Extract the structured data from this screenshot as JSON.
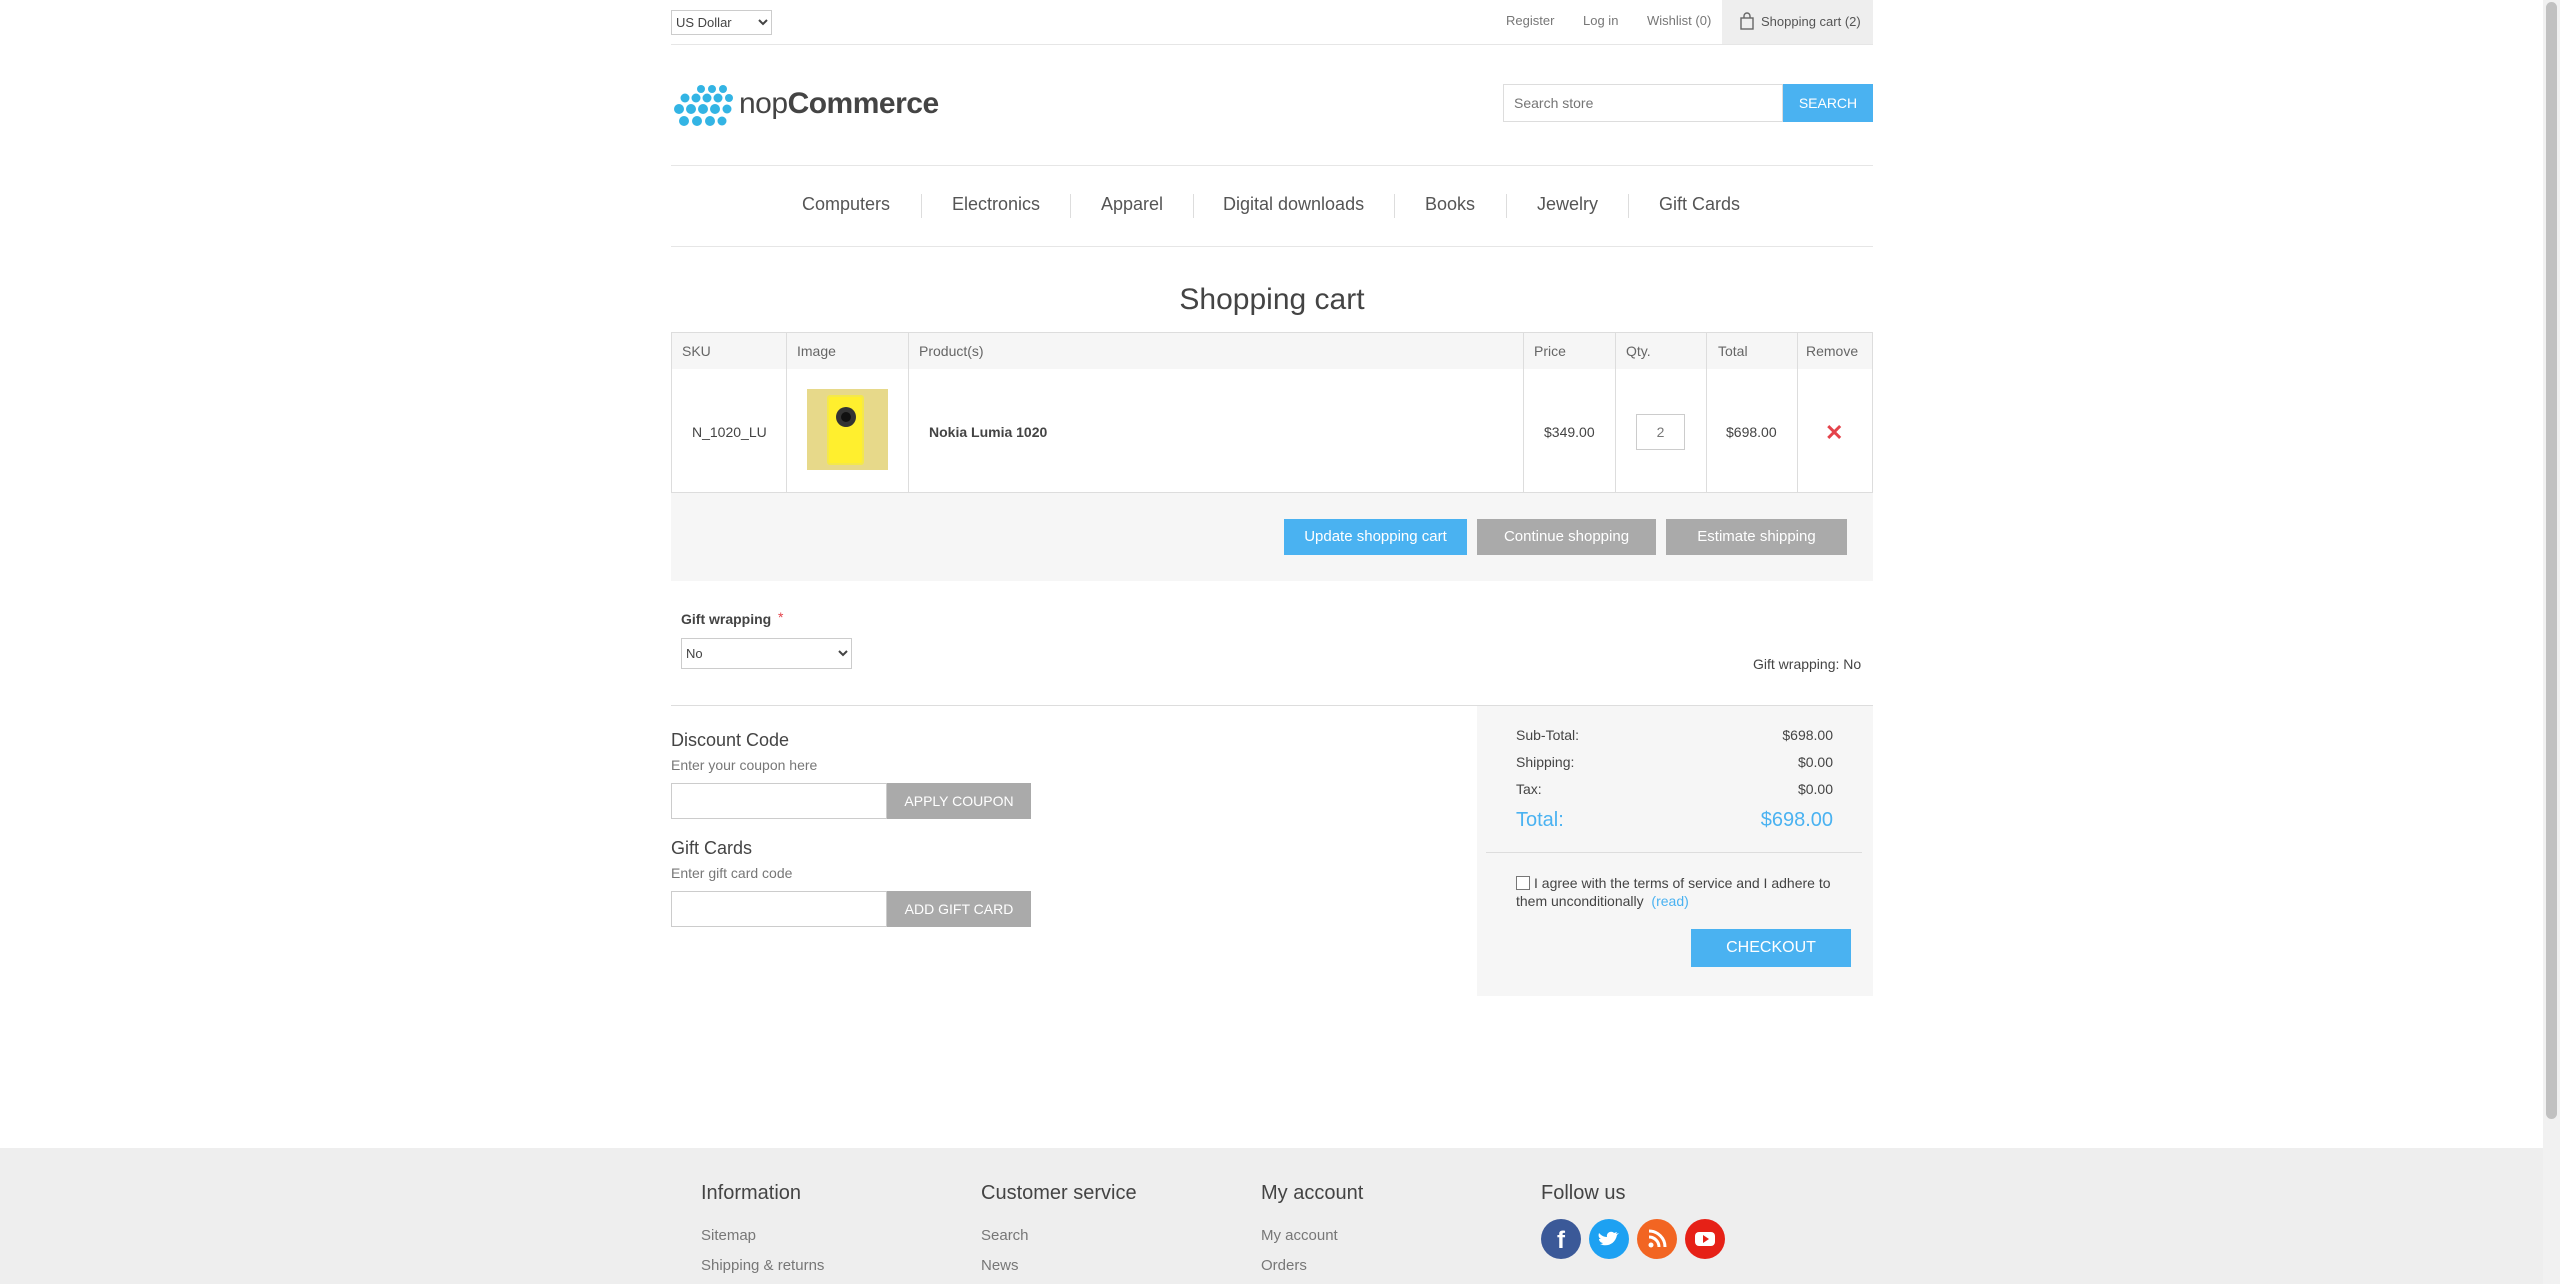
{
  "header": {
    "currency": "US Dollar",
    "links": {
      "register": "Register",
      "login": "Log in",
      "wishlist": "Wishlist (0)",
      "cart": "Shopping cart (2)"
    },
    "logo": {
      "light": "nop",
      "bold": "Commerce"
    },
    "search": {
      "placeholder": "Search store",
      "button": "SEARCH"
    }
  },
  "nav": [
    "Computers",
    "Electronics",
    "Apparel",
    "Digital downloads",
    "Books",
    "Jewelry",
    "Gift Cards"
  ],
  "page_title": "Shopping cart",
  "table": {
    "headers": {
      "sku": "SKU",
      "image": "Image",
      "product": "Product(s)",
      "price": "Price",
      "qty": "Qty.",
      "total": "Total",
      "remove": "Remove"
    },
    "row": {
      "sku": "N_1020_LU",
      "product": "Nokia Lumia 1020",
      "price": "$349.00",
      "qty": "2",
      "total": "$698.00",
      "remove_icon": "close-icon"
    }
  },
  "buttons": {
    "update": "Update shopping cart",
    "continue": "Continue shopping",
    "estimate": "Estimate shipping"
  },
  "gift_wrapping": {
    "label": "Gift wrapping",
    "required": "*",
    "selected": "No",
    "info": "Gift wrapping: No"
  },
  "discount": {
    "title": "Discount Code",
    "hint": "Enter your coupon here",
    "button": "APPLY COUPON"
  },
  "gift_cards": {
    "title": "Gift Cards",
    "hint": "Enter gift card code",
    "button": "ADD GIFT CARD"
  },
  "totals": {
    "subtotal_label": "Sub-Total:",
    "subtotal": "$698.00",
    "shipping_label": "Shipping:",
    "shipping": "$0.00",
    "tax_label": "Tax:",
    "tax": "$0.00",
    "total_label": "Total:",
    "total": "$698.00"
  },
  "terms": {
    "text": "I agree with the terms of service and I adhere to them unconditionally",
    "read": "(read)"
  },
  "checkout": "CHECKOUT",
  "footer": {
    "information": {
      "title": "Information",
      "links": [
        "Sitemap",
        "Shipping & returns"
      ]
    },
    "customer_service": {
      "title": "Customer service",
      "links": [
        "Search",
        "News"
      ]
    },
    "my_account": {
      "title": "My account",
      "links": [
        "My account",
        "Orders"
      ]
    },
    "follow_us": {
      "title": "Follow us",
      "icons": [
        "facebook-icon",
        "twitter-icon",
        "rss-icon",
        "youtube-icon"
      ]
    }
  },
  "colors": {
    "accent": "#4ab2f1",
    "remove": "#e4434b",
    "button_gray": "#aaaaaa",
    "facebook": "#3b5998",
    "twitter": "#1da1f2",
    "rss": "#f26522",
    "youtube": "#e62117"
  }
}
